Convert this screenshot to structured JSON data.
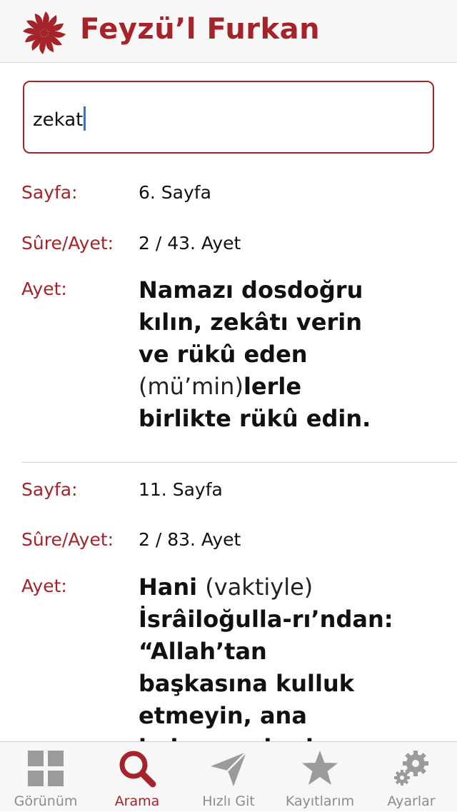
{
  "app": {
    "title": "Feyzü’l Furkan"
  },
  "search": {
    "query": "zekat"
  },
  "results": [
    {
      "sayfa_label": "Sayfa:",
      "sayfa_value": "6. Sayfa",
      "sure_label": "Sûre/Ayet:",
      "sure_value": "2 / 43. Ayet",
      "ayet_label": "Ayet:",
      "ayet_parts": [
        {
          "text": "Namazı dosdoğru kılın, zekâtı verin ve rükû eden ",
          "style": "bold"
        },
        {
          "text": "(mü’min)",
          "style": "light"
        },
        {
          "text": "lerle birlikte rükû edin.",
          "style": "bold"
        }
      ]
    },
    {
      "sayfa_label": "Sayfa:",
      "sayfa_value": "11. Sayfa",
      "sure_label": "Sûre/Ayet:",
      "sure_value": "2 / 83. Ayet",
      "ayet_label": "Ayet:",
      "ayet_parts": [
        {
          "text": "Hani ",
          "style": "bold"
        },
        {
          "text": "(vaktiyle)",
          "style": "light"
        },
        {
          "text": " İsrâiloğulla-rı’ndan: “Allah’tan başkasına kulluk etmeyin, ana babaya, akrabaya, yetimlere ve yoksullara",
          "style": "bold"
        }
      ]
    }
  ],
  "tabs": [
    {
      "label": "Görünüm",
      "icon": "grid-icon",
      "active": false
    },
    {
      "label": "Arama",
      "icon": "search-icon",
      "active": true
    },
    {
      "label": "Hızlı Git",
      "icon": "paper-plane-icon",
      "active": false
    },
    {
      "label": "Kayıtlarım",
      "icon": "star-icon",
      "active": false
    },
    {
      "label": "Ayarlar",
      "icon": "gears-icon",
      "active": false
    }
  ],
  "colors": {
    "accent": "#a5232a",
    "inactive": "#8c8c8c",
    "caret": "#3b6fd6"
  }
}
